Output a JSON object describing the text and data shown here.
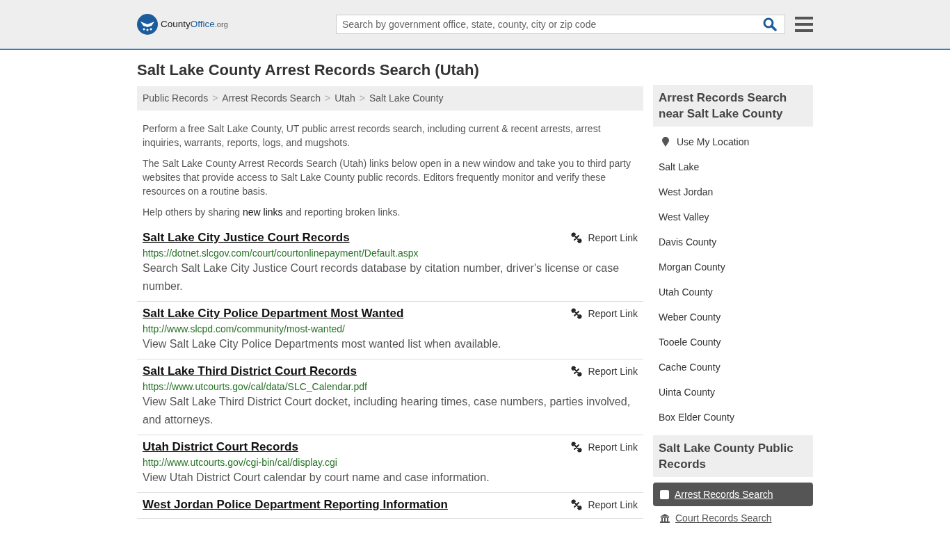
{
  "header": {
    "logo_text": "County",
    "logo_bold": "Office",
    "logo_suffix": ".org",
    "search": {
      "placeholder": "Search by government office, state, county, city or zip code"
    }
  },
  "title": "Salt Lake County Arrest Records Search (Utah)",
  "breadcrumb": [
    "Public Records",
    "Arrest Records Search",
    "Utah",
    "Salt Lake County"
  ],
  "breadcrumb_separator": ">",
  "intro": [
    "Perform a free Salt Lake County, UT public arrest records search, including current & recent arrests, arrest inquiries, warrants, reports, logs, and mugshots.",
    "The Salt Lake County Arrest Records Search (Utah) links below open in a new window and take you to third party websites that provide access to Salt Lake County public records. Editors frequently monitor and verify these resources on a routine basis."
  ],
  "share": {
    "before": "Help others by sharing ",
    "link": "new links",
    "after": " and reporting broken links."
  },
  "records": [
    {
      "title": "Salt Lake City Justice Court Records",
      "url": "https://dotnet.slcgov.com/court/courtonlinepayment/Default.aspx",
      "description": "Search Salt Lake City Justice Court records database by citation number, driver's license or case number.",
      "report": "Report Link"
    },
    {
      "title": "Salt Lake City Police Department Most Wanted",
      "url": "http://www.slcpd.com/community/most-wanted/",
      "description": "View Salt Lake City Police Departments most wanted list when available.",
      "report": "Report Link"
    },
    {
      "title": "Salt Lake Third District Court Records",
      "url": "https://www.utcourts.gov/cal/data/SLC_Calendar.pdf",
      "description": "View Salt Lake Third District Court docket, including hearing times, case numbers, parties involved, and attorneys.",
      "report": "Report Link"
    },
    {
      "title": "Utah District Court Records",
      "url": "http://www.utcourts.gov/cgi-bin/cal/display.cgi",
      "description": "View Utah District Court calendar by court name and case information.",
      "report": "Report Link"
    },
    {
      "title": "West Jordan Police Department Reporting Information",
      "report": "Report Link"
    }
  ],
  "sidebar": {
    "nearby_heading": "Arrest Records Search near Salt Lake County",
    "use_location": "Use My Location",
    "nearby": [
      "Salt Lake",
      "West Jordan",
      "West Valley",
      "Davis County",
      "Morgan County",
      "Utah County",
      "Weber County",
      "Tooele County",
      "Cache County",
      "Uinta County",
      "Box Elder County"
    ],
    "public_heading": "Salt Lake County Public Records",
    "public": [
      {
        "label": "Arrest Records Search",
        "selected": true,
        "kind": "square"
      },
      {
        "label": "Court Records Search",
        "selected": false,
        "kind": "courthouse"
      }
    ]
  }
}
